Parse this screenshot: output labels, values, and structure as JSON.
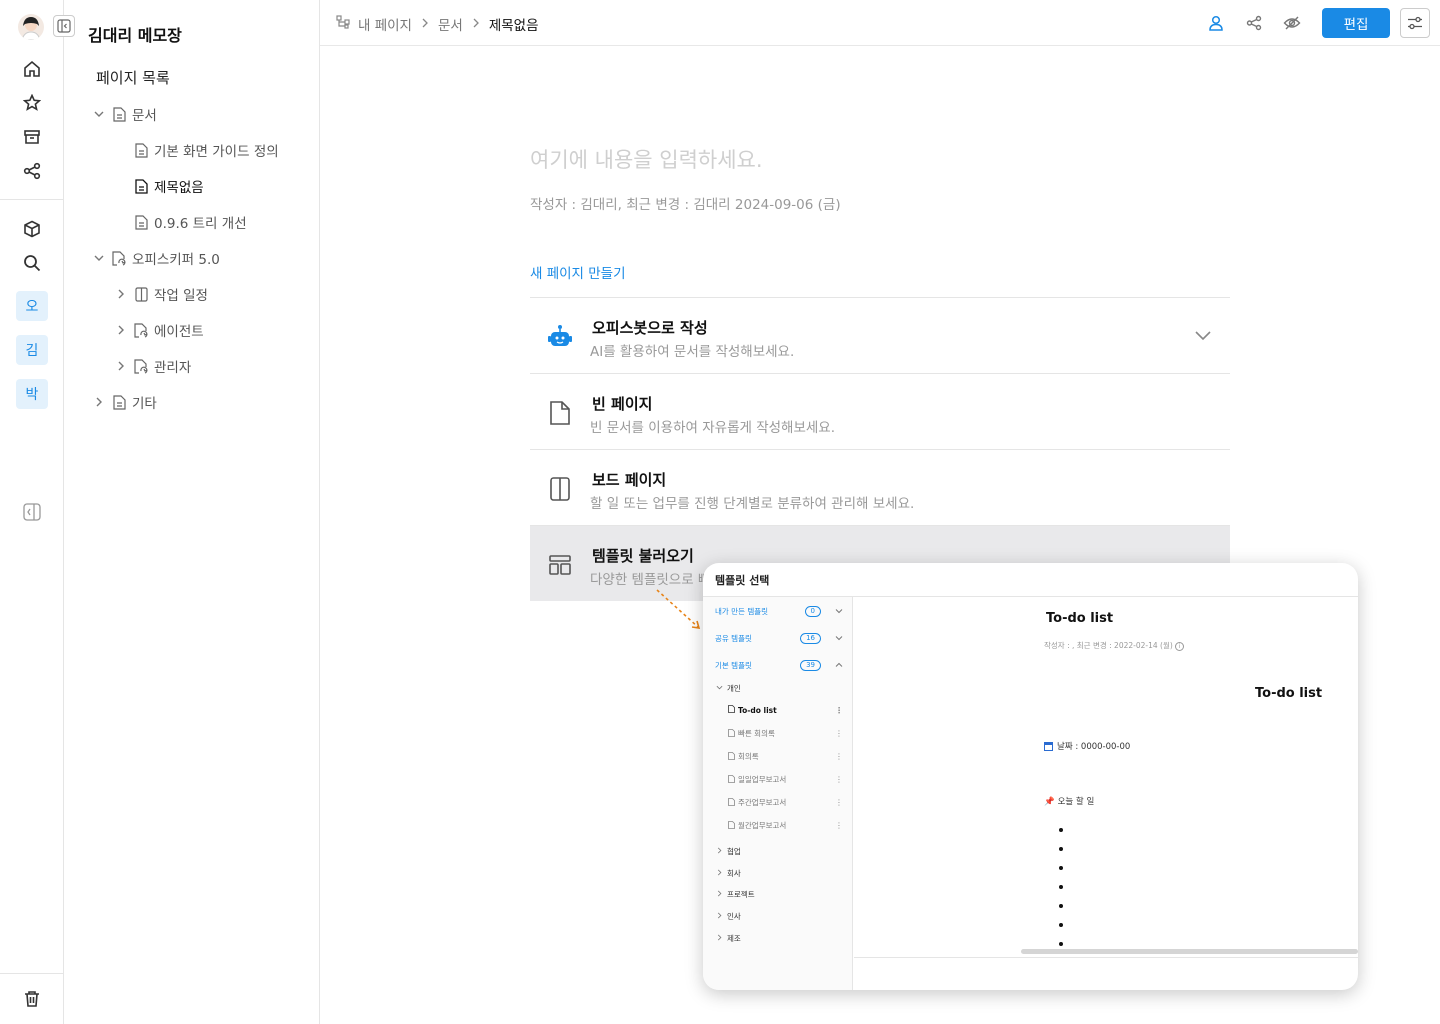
{
  "rail": {
    "workspaces": [
      "오",
      "김",
      "박"
    ]
  },
  "tree": {
    "app_title": "김대리 메모장",
    "list_title": "페이지 목록",
    "nodes": [
      {
        "label": "문서"
      },
      {
        "label": "기본 화면 가이드 정의"
      },
      {
        "label": "제목없음"
      },
      {
        "label": "0.9.6 트리 개선"
      },
      {
        "label": "오피스키퍼 5.0"
      },
      {
        "label": "작업 일정"
      },
      {
        "label": "에이전트"
      },
      {
        "label": "관리자"
      },
      {
        "label": "기타"
      }
    ]
  },
  "breadcrumb": {
    "items": [
      "내 페이지",
      "문서",
      "제목없음"
    ]
  },
  "toolbar": {
    "edit_label": "편집"
  },
  "page": {
    "placeholder": "여기에 내용을 입력하세요.",
    "meta": "작성자 : 김대리,  최근 변경 : 김대리  2024-09-06 (금)",
    "new_page_label": "새 페이지 만들기"
  },
  "options": [
    {
      "title": "오피스봇으로 작성",
      "desc": "AI를 활용하여 문서를 작성해보세요."
    },
    {
      "title": "빈 페이지",
      "desc": "빈 문서를 이용하여 자유롭게 작성해보세요."
    },
    {
      "title": "보드 페이지",
      "desc": "할 일 또는 업무를 진행 단계별로 분류하여 관리해 보세요."
    },
    {
      "title": "템플릿 불러오기",
      "desc": "다양한 템플릿으로 빠"
    }
  ],
  "modal": {
    "title": "템플릿 선택",
    "groups": [
      {
        "label": "내가 만든 템플릿",
        "count": "0"
      },
      {
        "label": "공유 템플릿",
        "count": "16"
      },
      {
        "label": "기본 템플릿",
        "count": "39"
      }
    ],
    "subgroup": "개인",
    "templates": [
      "To-do list",
      "빠른 회의록",
      "회의록",
      "일일업무보고서",
      "주간업무보고서",
      "월간업무보고서"
    ],
    "categories": [
      "협업",
      "회사",
      "프로젝트",
      "인사",
      "제조"
    ],
    "preview": {
      "title": "To-do list",
      "meta": "작성자 : ,  최근 변경 : 2022-02-14 (월)",
      "big_title": "To-do list",
      "date_line": "날짜 : 0000-00-00",
      "today_line": "오늘 할 일"
    }
  }
}
